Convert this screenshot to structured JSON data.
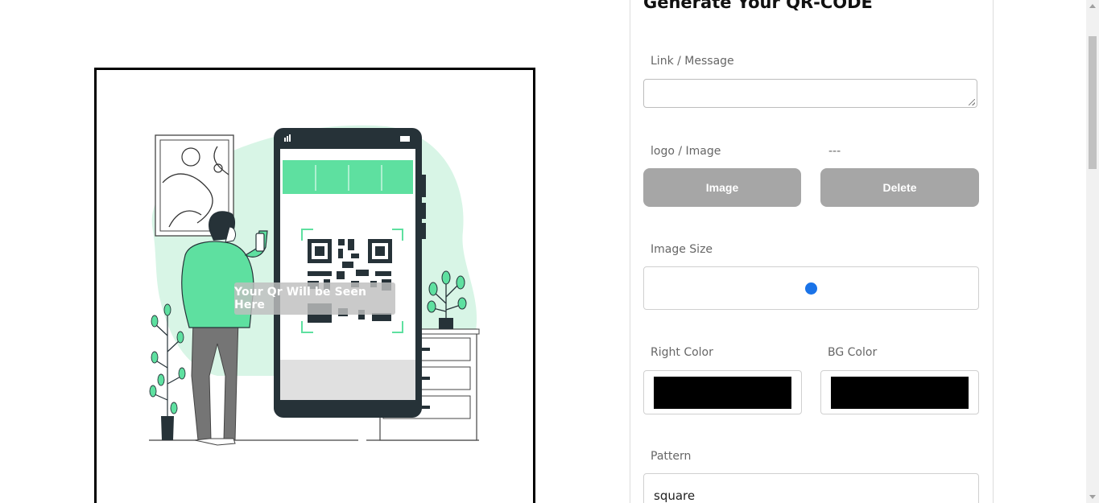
{
  "preview": {
    "overlay_text": "Your Qr Will be Seen Here"
  },
  "form": {
    "title": "Generate Your QR-CODE",
    "link_label": "Link / Message",
    "link_value": "",
    "logo_label": "logo / Image",
    "logo_filename": "---",
    "image_button": "Image",
    "delete_button": "Delete",
    "image_size_label": "Image Size",
    "image_size_value": 0.5,
    "right_color_label": "Right Color",
    "right_color": "#000000",
    "bg_color_label": "BG Color",
    "bg_color": "#000000",
    "pattern_label": "Pattern",
    "pattern_value": "square"
  },
  "colors": {
    "accent_green": "#5ee0a0",
    "light_green": "#d8f5e6",
    "button_gray": "#a6a6a6",
    "range_blue": "#1a73e8"
  }
}
